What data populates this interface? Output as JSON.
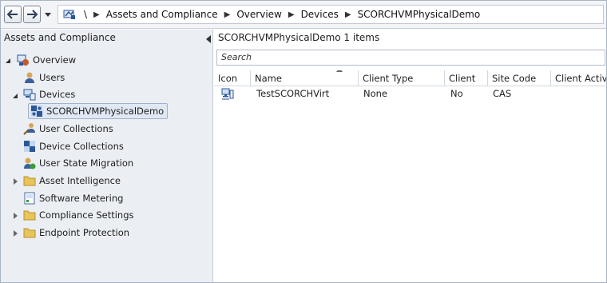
{
  "breadcrumb": {
    "root": "\\",
    "items": [
      "Assets and Compliance",
      "Devices",
      "SCORCHVMPhysicalDemo"
    ],
    "overview_label": "Overview"
  },
  "left_pane": {
    "title": "Assets and Compliance",
    "tree": {
      "overview": "Overview",
      "users": "Users",
      "devices": "Devices",
      "selected_collection": "SCORCHVMPhysicalDemo",
      "user_collections": "User Collections",
      "device_collections": "Device Collections",
      "user_state_migration": "User State Migration",
      "asset_intelligence": "Asset Intelligence",
      "software_metering": "Software Metering",
      "compliance_settings": "Compliance Settings",
      "endpoint_protection": "Endpoint Protection"
    }
  },
  "right_pane": {
    "title": "SCORCHVMPhysicalDemo 1 items",
    "search_placeholder": "Search",
    "columns": [
      "Icon",
      "Name",
      "Client Type",
      "Client",
      "Site Code",
      "Client Activity"
    ],
    "rows": [
      {
        "name": "TestSCORCHVirt",
        "client_type": "None",
        "client": "No",
        "site_code": "CAS"
      }
    ]
  },
  "icons": {
    "back": "back-arrow-icon",
    "forward": "forward-arrow-icon",
    "folder": "folder-icon",
    "computer": "computer-icon"
  },
  "colors": {
    "accent": "#2b5797",
    "folder": "#e8c45a",
    "pane_bg": "#ebeef3",
    "selection": "#e0e8f4"
  }
}
